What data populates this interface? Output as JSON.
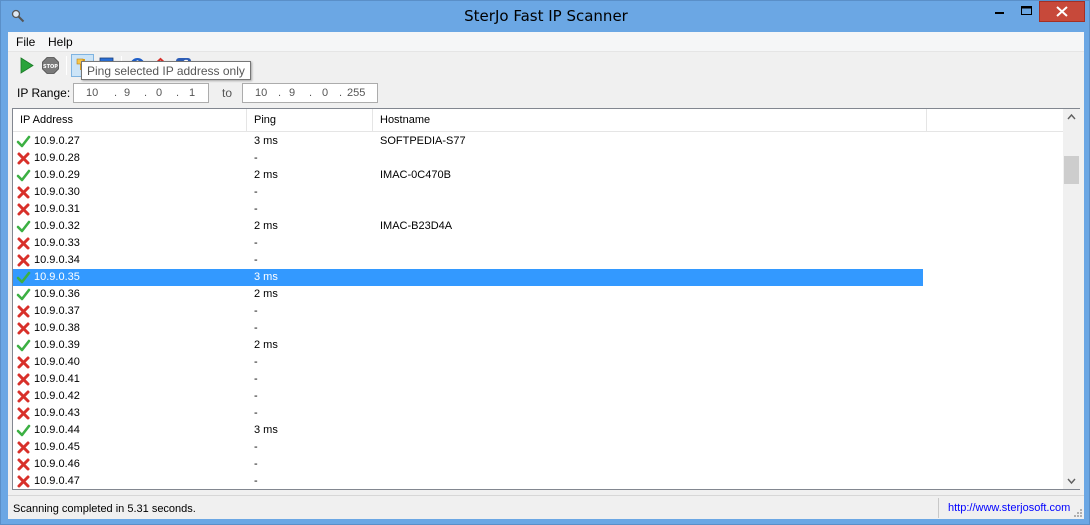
{
  "window": {
    "title": "SterJo Fast IP Scanner"
  },
  "menu": {
    "items": [
      "File",
      "Help"
    ]
  },
  "toolbar": {
    "buttons": [
      {
        "name": "start-scan-button",
        "icon": "play-icon"
      },
      {
        "name": "stop-scan-button",
        "icon": "stop-icon"
      },
      {
        "name": "ping-selected-button",
        "icon": "ping-icon",
        "pressed": true
      },
      {
        "name": "network-computer-button",
        "icon": "computer-icon"
      },
      {
        "name": "about-button",
        "icon": "info-icon"
      },
      {
        "name": "homepage-button",
        "icon": "home-icon"
      },
      {
        "name": "facebook-button",
        "icon": "facebook-icon"
      }
    ],
    "stop_label": "STOP"
  },
  "range": {
    "label": "IP Range:",
    "to_label": "to",
    "from": [
      "10",
      "9",
      "0",
      "1"
    ],
    "to": [
      "10",
      "9",
      "0",
      "255"
    ],
    "separator": "."
  },
  "tooltip": {
    "text": "Ping selected IP address only"
  },
  "columns": [
    "IP Address",
    "Ping",
    "Hostname"
  ],
  "rows": [
    {
      "ip": "10.9.0.27",
      "ping": "3 ms",
      "host": "SOFTPEDIA-S77",
      "status": "up"
    },
    {
      "ip": "10.9.0.28",
      "ping": "-",
      "host": "",
      "status": "down"
    },
    {
      "ip": "10.9.0.29",
      "ping": "2 ms",
      "host": "IMAC-0C470B",
      "status": "up"
    },
    {
      "ip": "10.9.0.30",
      "ping": "-",
      "host": "",
      "status": "down"
    },
    {
      "ip": "10.9.0.31",
      "ping": "-",
      "host": "",
      "status": "down"
    },
    {
      "ip": "10.9.0.32",
      "ping": "2 ms",
      "host": "IMAC-B23D4A",
      "status": "up"
    },
    {
      "ip": "10.9.0.33",
      "ping": "-",
      "host": "",
      "status": "down"
    },
    {
      "ip": "10.9.0.34",
      "ping": "-",
      "host": "",
      "status": "down"
    },
    {
      "ip": "10.9.0.35",
      "ping": "3 ms",
      "host": "",
      "status": "up",
      "selected": true
    },
    {
      "ip": "10.9.0.36",
      "ping": "2 ms",
      "host": "",
      "status": "up"
    },
    {
      "ip": "10.9.0.37",
      "ping": "-",
      "host": "",
      "status": "down"
    },
    {
      "ip": "10.9.0.38",
      "ping": "-",
      "host": "",
      "status": "down"
    },
    {
      "ip": "10.9.0.39",
      "ping": "2 ms",
      "host": "",
      "status": "up"
    },
    {
      "ip": "10.9.0.40",
      "ping": "-",
      "host": "",
      "status": "down"
    },
    {
      "ip": "10.9.0.41",
      "ping": "-",
      "host": "",
      "status": "down"
    },
    {
      "ip": "10.9.0.42",
      "ping": "-",
      "host": "",
      "status": "down"
    },
    {
      "ip": "10.9.0.43",
      "ping": "-",
      "host": "",
      "status": "down"
    },
    {
      "ip": "10.9.0.44",
      "ping": "3 ms",
      "host": "",
      "status": "up"
    },
    {
      "ip": "10.9.0.45",
      "ping": "-",
      "host": "",
      "status": "down"
    },
    {
      "ip": "10.9.0.46",
      "ping": "-",
      "host": "",
      "status": "down"
    },
    {
      "ip": "10.9.0.47",
      "ping": "-",
      "host": "",
      "status": "down"
    }
  ],
  "status": {
    "text": "Scanning completed in 5.31 seconds.",
    "link": "http://www.sterjosoft.com"
  },
  "colors": {
    "frame": "#6ba7e4",
    "selection": "#3399ff",
    "up_check": "#3cb043",
    "down_x": "#d8302a"
  }
}
